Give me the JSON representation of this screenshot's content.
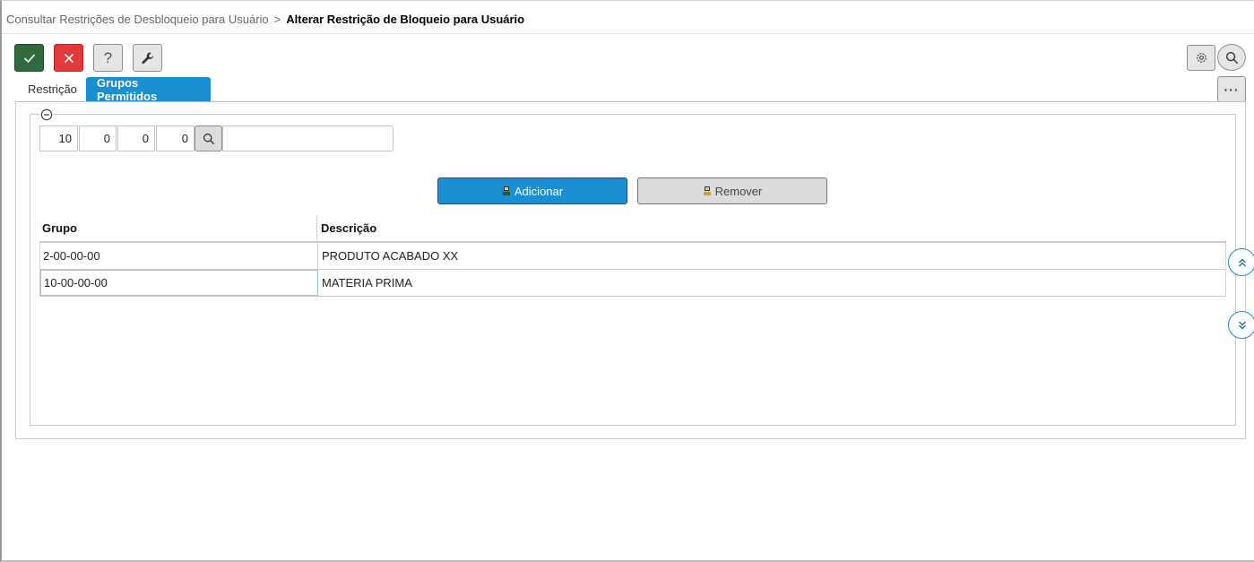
{
  "breadcrumb": {
    "parent": "Consultar Restrições de Desbloqueio para Usuário",
    "separator": ">",
    "current": "Alterar Restrição de Bloqueio para Usuário"
  },
  "toolbar": {
    "help_label": "?"
  },
  "more_label": "···",
  "tabs": {
    "restricao": "Restrição",
    "grupos": "Grupos Permitidos"
  },
  "group_code": {
    "part1": "10",
    "part2": "0",
    "part3": "0",
    "part4": "0",
    "description": ""
  },
  "actions": {
    "add_label": "Adicionar",
    "remove_label": "Remover"
  },
  "table": {
    "columns": [
      "Grupo",
      "Descrição"
    ],
    "rows": [
      {
        "grupo": "2-00-00-00",
        "descricao": "PRODUTO ACABADO XX"
      },
      {
        "grupo": "10-00-00-00",
        "descricao": "MATERIA PRIMA"
      }
    ]
  },
  "colors": {
    "accent": "#1a8ed0",
    "confirm": "#2f6b3c",
    "cancel": "#e53a3a"
  },
  "icons": {
    "confirm": "check-icon",
    "cancel": "close-icon",
    "help": "question-icon",
    "tools": "wrench-icon",
    "settings": "gear-icon",
    "search": "search-icon",
    "collapse": "minus-circle-icon",
    "scroll_up": "double-chevron-up-icon",
    "scroll_down": "double-chevron-down-icon"
  }
}
